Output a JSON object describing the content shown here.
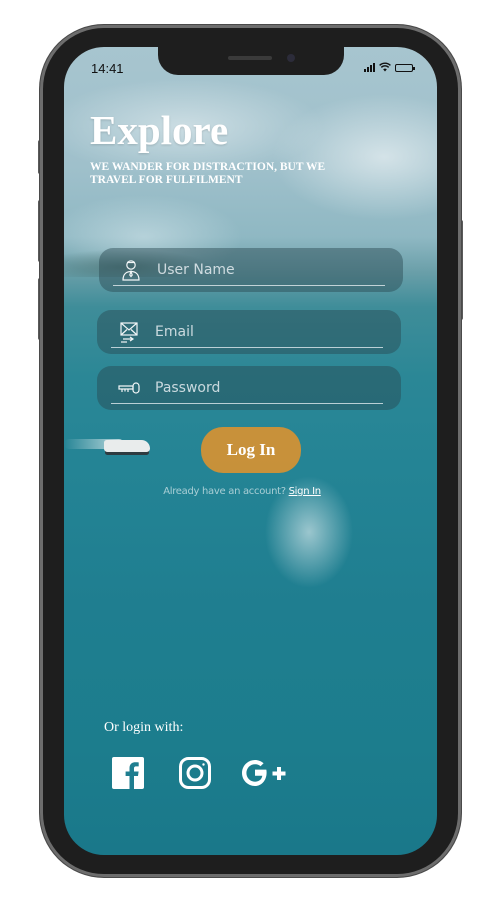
{
  "status_bar": {
    "time": "14:41"
  },
  "header": {
    "title": "Explore",
    "subtitle": "WE WANDER FOR DISTRACTION, BUT WE TRAVEL FOR FULFILMENT"
  },
  "form": {
    "username": {
      "placeholder": "User Name",
      "value": "",
      "icon": "user-icon"
    },
    "email": {
      "placeholder": "Email",
      "value": "",
      "icon": "envelope-icon"
    },
    "password": {
      "placeholder": "Password",
      "value": "",
      "icon": "key-icon"
    },
    "login_label": "Log In",
    "account_prompt": "Already have an account?",
    "signin_label": "Sign In"
  },
  "social": {
    "label": "Or login with:",
    "providers": [
      "facebook-icon",
      "instagram-icon",
      "google-plus-icon"
    ]
  },
  "colors": {
    "accent": "#D69232",
    "text": "#FFFFFF"
  }
}
